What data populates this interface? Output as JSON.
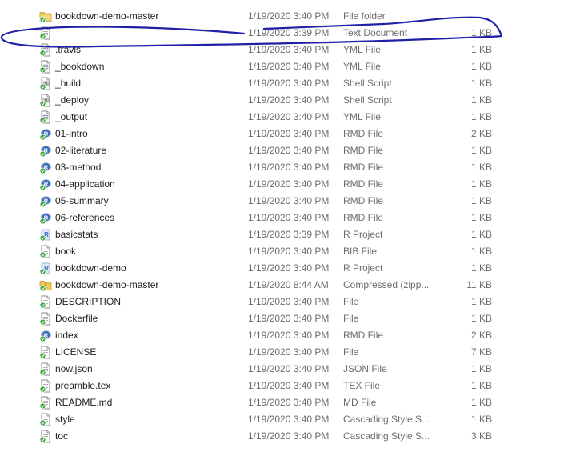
{
  "files": [
    {
      "name": "bookdown-demo-master",
      "date": "1/19/2020 3:40 PM",
      "type": "File folder",
      "size": "",
      "icon": "folder-icon"
    },
    {
      "name": "",
      "date": "1/19/2020 3:39 PM",
      "type": "Text Document",
      "size": "1 KB",
      "icon": "text-document-icon"
    },
    {
      "name": ".travis",
      "date": "1/19/2020 3:40 PM",
      "type": "YML File",
      "size": "1 KB",
      "icon": "yml-file-icon"
    },
    {
      "name": "_bookdown",
      "date": "1/19/2020 3:40 PM",
      "type": "YML File",
      "size": "1 KB",
      "icon": "yml-file-icon"
    },
    {
      "name": "_build",
      "date": "1/19/2020 3:40 PM",
      "type": "Shell Script",
      "size": "1 KB",
      "icon": "shell-script-icon"
    },
    {
      "name": "_deploy",
      "date": "1/19/2020 3:40 PM",
      "type": "Shell Script",
      "size": "1 KB",
      "icon": "shell-script-icon"
    },
    {
      "name": "_output",
      "date": "1/19/2020 3:40 PM",
      "type": "YML File",
      "size": "1 KB",
      "icon": "yml-file-icon"
    },
    {
      "name": "01-intro",
      "date": "1/19/2020 3:40 PM",
      "type": "RMD File",
      "size": "2 KB",
      "icon": "rmd-file-icon"
    },
    {
      "name": "02-literature",
      "date": "1/19/2020 3:40 PM",
      "type": "RMD File",
      "size": "1 KB",
      "icon": "rmd-file-icon"
    },
    {
      "name": "03-method",
      "date": "1/19/2020 3:40 PM",
      "type": "RMD File",
      "size": "1 KB",
      "icon": "rmd-file-icon"
    },
    {
      "name": "04-application",
      "date": "1/19/2020 3:40 PM",
      "type": "RMD File",
      "size": "1 KB",
      "icon": "rmd-file-icon"
    },
    {
      "name": "05-summary",
      "date": "1/19/2020 3:40 PM",
      "type": "RMD File",
      "size": "1 KB",
      "icon": "rmd-file-icon"
    },
    {
      "name": "06-references",
      "date": "1/19/2020 3:40 PM",
      "type": "RMD File",
      "size": "1 KB",
      "icon": "rmd-file-icon"
    },
    {
      "name": "basicstats",
      "date": "1/19/2020 3:39 PM",
      "type": "R Project",
      "size": "1 KB",
      "icon": "r-project-icon"
    },
    {
      "name": "book",
      "date": "1/19/2020 3:40 PM",
      "type": "BIB File",
      "size": "1 KB",
      "icon": "bib-file-icon"
    },
    {
      "name": "bookdown-demo",
      "date": "1/19/2020 3:40 PM",
      "type": "R Project",
      "size": "1 KB",
      "icon": "r-project-icon"
    },
    {
      "name": "bookdown-demo-master",
      "date": "1/19/2020 8:44 AM",
      "type": "Compressed (zipp...",
      "size": "11 KB",
      "icon": "zip-folder-icon"
    },
    {
      "name": "DESCRIPTION",
      "date": "1/19/2020 3:40 PM",
      "type": "File",
      "size": "1 KB",
      "icon": "file-icon"
    },
    {
      "name": "Dockerfile",
      "date": "1/19/2020 3:40 PM",
      "type": "File",
      "size": "1 KB",
      "icon": "file-icon"
    },
    {
      "name": "index",
      "date": "1/19/2020 3:40 PM",
      "type": "RMD File",
      "size": "2 KB",
      "icon": "rmd-file-icon"
    },
    {
      "name": "LICENSE",
      "date": "1/19/2020 3:40 PM",
      "type": "File",
      "size": "7 KB",
      "icon": "file-icon"
    },
    {
      "name": "now.json",
      "date": "1/19/2020 3:40 PM",
      "type": "JSON File",
      "size": "1 KB",
      "icon": "json-file-icon"
    },
    {
      "name": "preamble.tex",
      "date": "1/19/2020 3:40 PM",
      "type": "TEX File",
      "size": "1 KB",
      "icon": "tex-file-icon"
    },
    {
      "name": "README.md",
      "date": "1/19/2020 3:40 PM",
      "type": "MD File",
      "size": "1 KB",
      "icon": "md-file-icon"
    },
    {
      "name": "style",
      "date": "1/19/2020 3:40 PM",
      "type": "Cascading Style S...",
      "size": "1 KB",
      "icon": "css-file-icon"
    },
    {
      "name": "toc",
      "date": "1/19/2020 3:40 PM",
      "type": "Cascading Style S...",
      "size": "3 KB",
      "icon": "css-file-icon"
    }
  ],
  "colors": {
    "text": "#1e1e1e",
    "secondary_text": "#6d6d6d",
    "annotation_ink": "#1f1fa8",
    "folder": "#f0c85a",
    "r_blue": "#2f6bc4",
    "check_green": "#3aa63a"
  }
}
